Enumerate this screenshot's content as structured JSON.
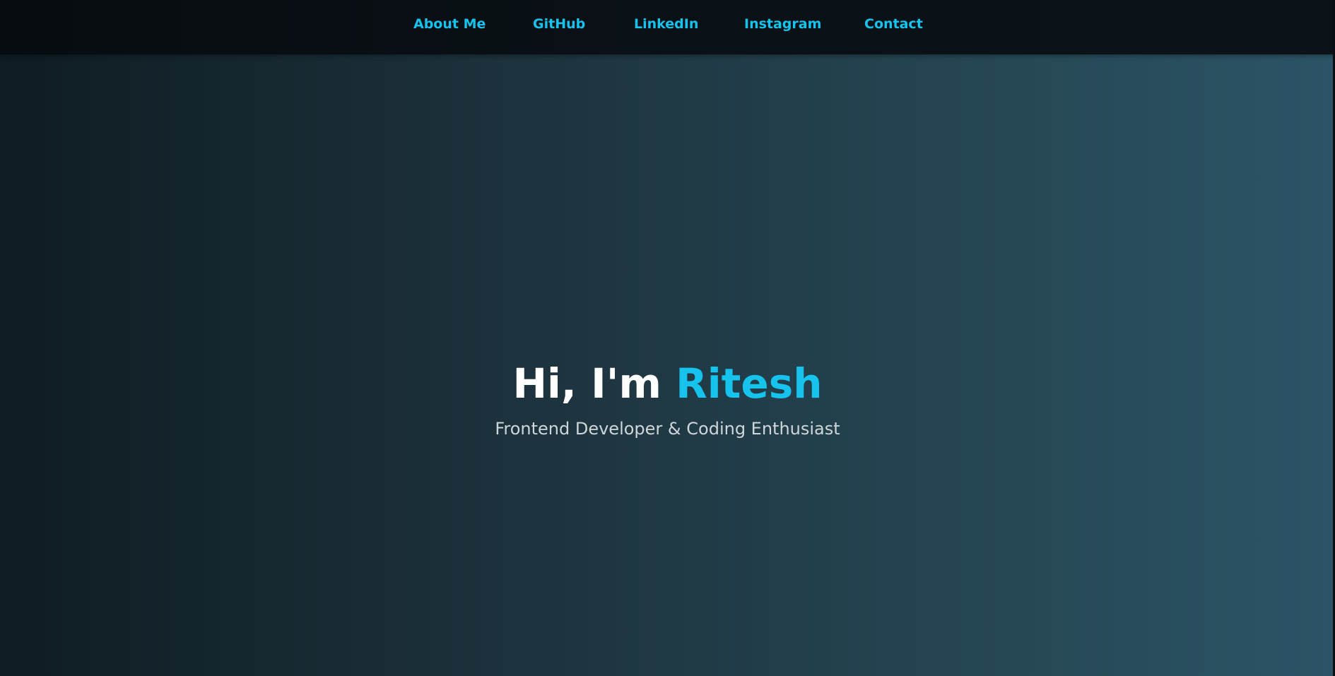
{
  "nav": {
    "items": [
      {
        "label": "About Me"
      },
      {
        "label": "GitHub"
      },
      {
        "label": "LinkedIn"
      },
      {
        "label": "Instagram"
      },
      {
        "label": "Contact"
      }
    ]
  },
  "hero": {
    "greeting": "Hi, I'm ",
    "name": "Ritesh",
    "subtitle": "Frontend Developer & Coding Enthusiast"
  },
  "colors": {
    "accent": "#16c3ec",
    "nav_background": "#090f14",
    "title_text": "#ffffff",
    "subtitle_text": "#cfd6da"
  }
}
